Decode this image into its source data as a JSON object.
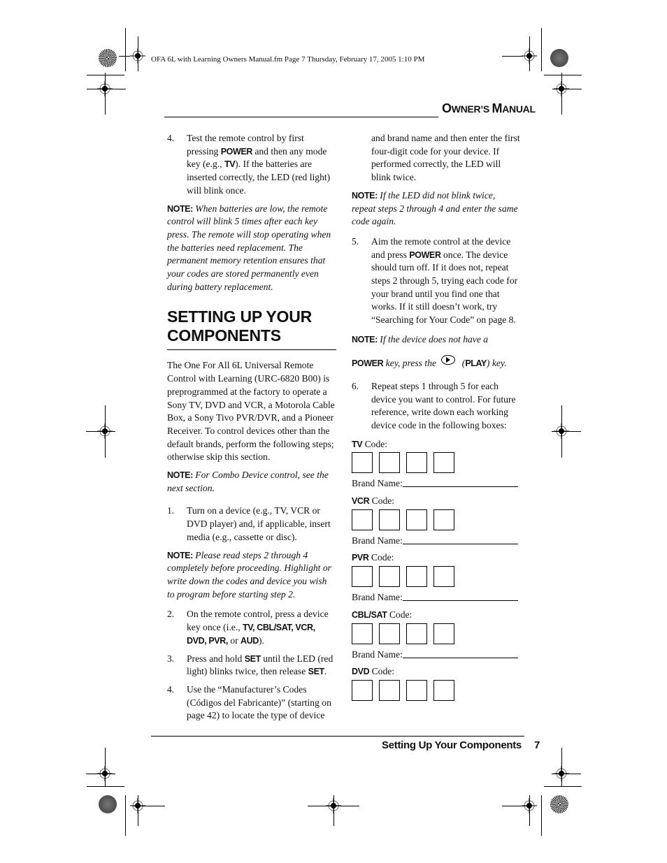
{
  "slug_line": "OFA 6L with Learning Owners Manual.fm  Page 7  Thursday, February 17, 2005  1:10 PM",
  "running_head": {
    "first_letter_1": "O",
    "rest_1": "WNER’S ",
    "first_letter_2": "M",
    "rest_2": "ANUAL"
  },
  "left_column": {
    "step4": {
      "num": "4.",
      "t1": "Test the remote control by first pressing ",
      "k1": "POWER",
      "t2": " and then any mode key (e.g., ",
      "k2": "TV",
      "t3": "). If the batteries are inserted correctly, the LED (red light) will blink once."
    },
    "note1": {
      "label": "NOTE:",
      "body": " When batteries are low, the remote control will blink 5 times after each key press. The remote will stop operating when the batteries need replacement. The permanent memory retention ensures that your codes are stored permanently even during battery replacement."
    },
    "section_title": "SETTING UP YOUR COMPONENTS",
    "intro": "The One For All 6L Universal Remote Control with Learning (URC-6820 B00) is preprogrammed at the factory to operate a Sony TV, DVD and VCR, a Motorola Cable Box, a Sony Tivo PVR/DVR, and a Pioneer Receiver. To control devices other than the default brands, perform the following steps; otherwise skip this section.",
    "note2": {
      "label": "NOTE:",
      "body": " For Combo Device control, see the next section."
    },
    "step1": {
      "num": "1.",
      "text": "Turn on a device (e.g., TV, VCR or DVD player) and, if applicable, insert media (e.g., cassette or disc)."
    },
    "note3": {
      "label": "NOTE:",
      "body": " Please read steps 2 through 4 completely before proceeding. Highlight or write down the codes and device you wish to program before starting step 2."
    },
    "step2": {
      "num": "2.",
      "t1": "On the remote control, press a device key once (i.e., ",
      "k1": "TV, CBL/SAT, VCR, DVD, PVR,",
      "t2": " or ",
      "k2": "AUD",
      "t3": ")."
    },
    "step3": {
      "num": "3.",
      "t1": "Press and hold ",
      "k1": "SET",
      "t2": " until the LED (red light) blinks twice, then release ",
      "k2": "SET",
      "t3": "."
    },
    "step4b": {
      "num": "4.",
      "text": "Use the “Manufacturer’s Codes (Códigos del Fabricante)” (starting on page 42) to locate the type of device"
    }
  },
  "right_column": {
    "step4_cont": "and brand name and then enter the first four-digit code for your device. If performed correctly, the LED will blink twice.",
    "note4": {
      "label": "NOTE:",
      "body": " If the LED did not blink twice, repeat steps 2 through 4 and enter the same code again."
    },
    "step5": {
      "num": "5.",
      "t1": "Aim the remote control at the device and press ",
      "k1": "POWER",
      "t2": " once. The device should turn off. If it does not, repeat steps 2 through 5, trying each code for your brand until you find one that works. If it still doesn’t work, try “Searching for Your Code” on page 8."
    },
    "note5": {
      "label": "NOTE:",
      "b1": " If the device does not have a ",
      "k1": "POWER",
      "b2": " key, press the ",
      "icon": "play-icon",
      "b3": " (",
      "k2": "PLAY",
      "b4": ") key."
    },
    "step6": {
      "num": "6.",
      "text": "Repeat steps 1 through 5 for each device you want to control. For future reference, write down each working device code in the following boxes:"
    },
    "code_suffix": " Code:",
    "brand_label": "Brand Name:",
    "devices": [
      {
        "key": "TV",
        "code_digits": [
          "",
          "",
          "",
          ""
        ],
        "brand": ""
      },
      {
        "key": "VCR",
        "code_digits": [
          "",
          "",
          "",
          ""
        ],
        "brand": ""
      },
      {
        "key": "PVR",
        "code_digits": [
          "",
          "",
          "",
          ""
        ],
        "brand": ""
      },
      {
        "key": "CBL/SAT",
        "code_digits": [
          "",
          "",
          "",
          ""
        ],
        "brand": ""
      },
      {
        "key": "DVD",
        "code_digits": [
          "",
          "",
          "",
          ""
        ]
      }
    ]
  },
  "footer": {
    "section": "Setting Up Your Components",
    "page": "7"
  }
}
